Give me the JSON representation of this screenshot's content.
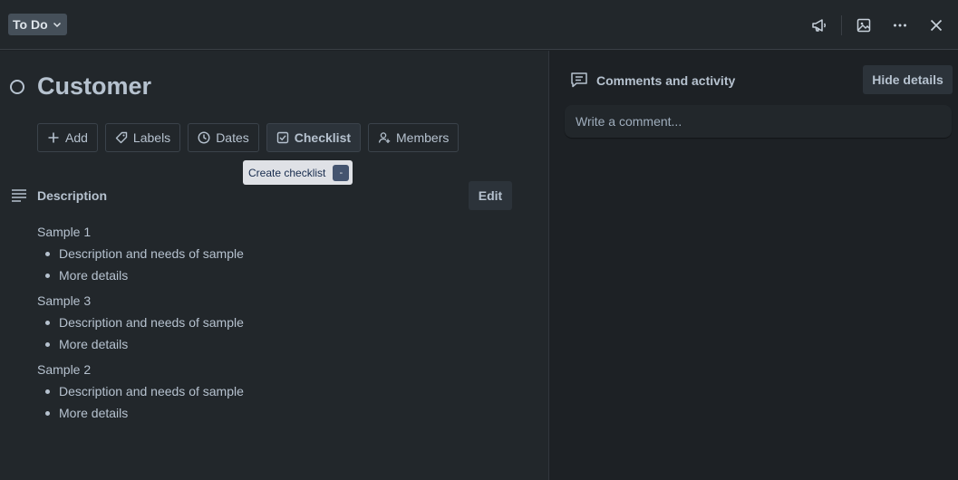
{
  "header": {
    "list_name": "To Do",
    "icons": [
      "megaphone-icon",
      "image-icon",
      "more-icon",
      "close-icon"
    ]
  },
  "card": {
    "title": "Customer",
    "actions": [
      {
        "label": "Add",
        "icon": "plus-icon"
      },
      {
        "label": "Labels",
        "icon": "tag-icon"
      },
      {
        "label": "Dates",
        "icon": "clock-icon"
      },
      {
        "label": "Checklist",
        "icon": "checkbox-icon"
      },
      {
        "label": "Members",
        "icon": "add-member-icon"
      }
    ],
    "tooltip": {
      "text": "Create checklist",
      "shortcut": "-"
    }
  },
  "description": {
    "title": "Description",
    "edit_label": "Edit",
    "sections": [
      {
        "heading": "Sample 1",
        "items": [
          "Description and needs of sample",
          "More details"
        ]
      },
      {
        "heading": "Sample 3",
        "items": [
          "Description and needs of sample",
          "More details"
        ]
      },
      {
        "heading": "Sample 2",
        "items": [
          "Description and needs of sample",
          "More details"
        ]
      }
    ]
  },
  "activity": {
    "title": "Comments and activity",
    "hide_label": "Hide details",
    "comment_placeholder": "Write a comment..."
  },
  "colors": {
    "page_bg": "#1d2125",
    "panel_bg": "#22272b",
    "text": "#b6c2cf",
    "button_bg": "#2c333a",
    "tooltip_bg": "#dfe1e6"
  }
}
